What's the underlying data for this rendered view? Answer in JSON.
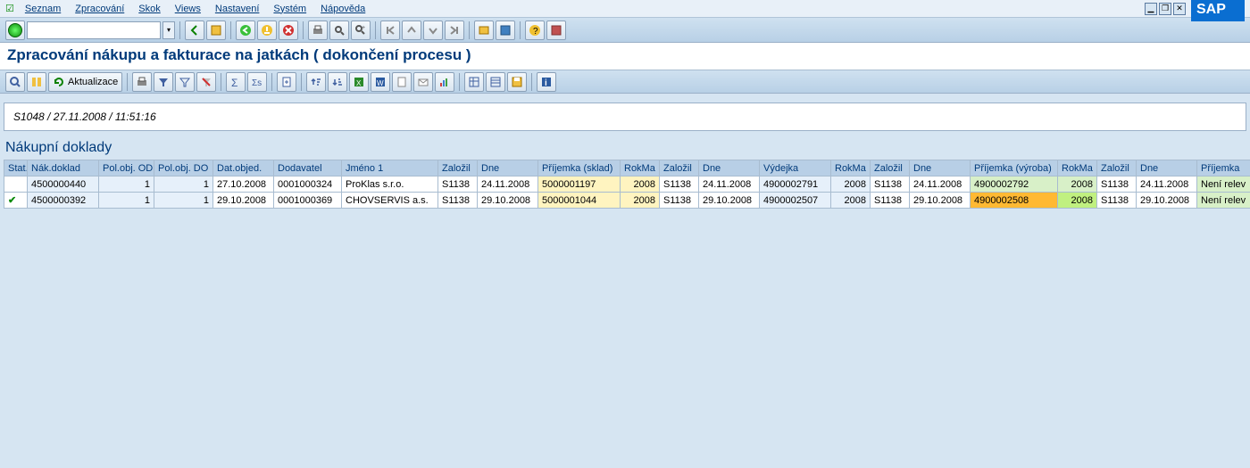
{
  "menu": [
    "Seznam",
    "Zpracování",
    "Skok",
    "Views",
    "Nastavení",
    "Systém",
    "Nápověda"
  ],
  "page_title": "Zpracování nákupu a fakturace na jatkách ( dokončení procesu )",
  "meta_line": "S1048 / 27.11.2008 / 11:51:16",
  "section_title": "Nákupní doklady",
  "refresh_label": "Aktualizace",
  "columns": [
    "Stat.",
    "Nák.doklad",
    "Pol.obj. OD",
    "Pol.obj. DO",
    "Dat.objed.",
    "Dodavatel",
    "Jméno 1",
    "Založil",
    "Dne",
    "Příjemka (sklad)",
    "RokMa",
    "Založil",
    "Dne",
    "Výdejka",
    "RokMa",
    "Založil",
    "Dne",
    "Příjemka (výroba)",
    "RokMa",
    "Založil",
    "Dne",
    "Příjemka"
  ],
  "rows": [
    {
      "status": "",
      "nak_doklad": "4500000440",
      "pol_od": "1",
      "pol_do": "1",
      "dat_objed": "27.10.2008",
      "dodavatel": "0001000324",
      "jmeno": "ProKlas s.r.o.",
      "zalozil1": "S1138",
      "dne1": "24.11.2008",
      "prijemka_sklad": "5000001197",
      "rokma1": "2008",
      "zalozil2": "S1138",
      "dne2": "24.11.2008",
      "vydejka": "4900002791",
      "rokma2": "2008",
      "zalozil3": "S1138",
      "dne3": "24.11.2008",
      "prijemka_vyroba": "4900002792",
      "rokma3": "2008",
      "zalozil4": "S1138",
      "dne4": "24.11.2008",
      "prijemka2": "Není relev"
    },
    {
      "status": "ok",
      "nak_doklad": "4500000392",
      "pol_od": "1",
      "pol_do": "1",
      "dat_objed": "29.10.2008",
      "dodavatel": "0001000369",
      "jmeno": "CHOVSERVIS a.s.",
      "zalozil1": "S1138",
      "dne1": "29.10.2008",
      "prijemka_sklad": "5000001044",
      "rokma1": "2008",
      "zalozil2": "S1138",
      "dne2": "29.10.2008",
      "vydejka": "4900002507",
      "rokma2": "2008",
      "zalozil3": "S1138",
      "dne3": "29.10.2008",
      "prijemka_vyroba": "4900002508",
      "rokma3": "2008",
      "zalozil4": "S1138",
      "dne4": "29.10.2008",
      "prijemka2": "Není relev"
    }
  ]
}
